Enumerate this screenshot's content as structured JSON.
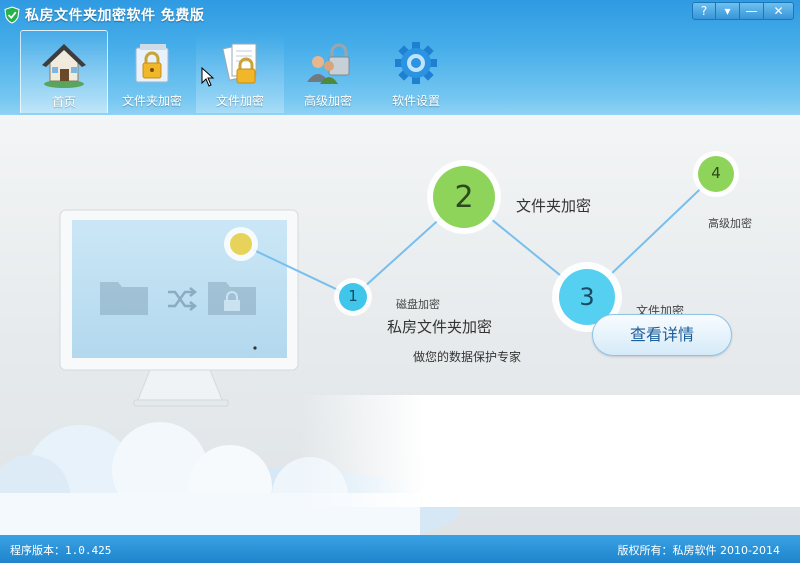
{
  "window": {
    "title": "私房文件夹加密软件  免费版",
    "controls": [
      "?",
      "▾",
      "—",
      "✕"
    ]
  },
  "toolbar": {
    "items": [
      {
        "label": "首页",
        "icon": "home-icon",
        "active": true
      },
      {
        "label": "文件夹加密",
        "icon": "folder-lock-icon"
      },
      {
        "label": "文件加密",
        "icon": "file-lock-icon",
        "hover": true
      },
      {
        "label": "高级加密",
        "icon": "users-lock-icon"
      },
      {
        "label": "软件设置",
        "icon": "gear-icon"
      }
    ]
  },
  "steps": {
    "s1": {
      "number": "1",
      "label": "磁盘加密"
    },
    "s2": {
      "number": "2",
      "label": "文件夹加密"
    },
    "s3": {
      "number": "3",
      "label": "文件加密"
    },
    "s4": {
      "number": "4",
      "label": "高级加密"
    }
  },
  "promo": {
    "title": "私房文件夹加密",
    "subtitle": "做您的数据保护专家",
    "button": "查看详情"
  },
  "footer": {
    "version": "程序版本：1.0.425",
    "copyright": "版权所有：私房软件 2010-2014"
  },
  "colors": {
    "accent": "#2b8fd6",
    "step_green": "#8fd45a",
    "step_cyan": "#3fc6ea",
    "step_yellow": "#e7d35a"
  }
}
